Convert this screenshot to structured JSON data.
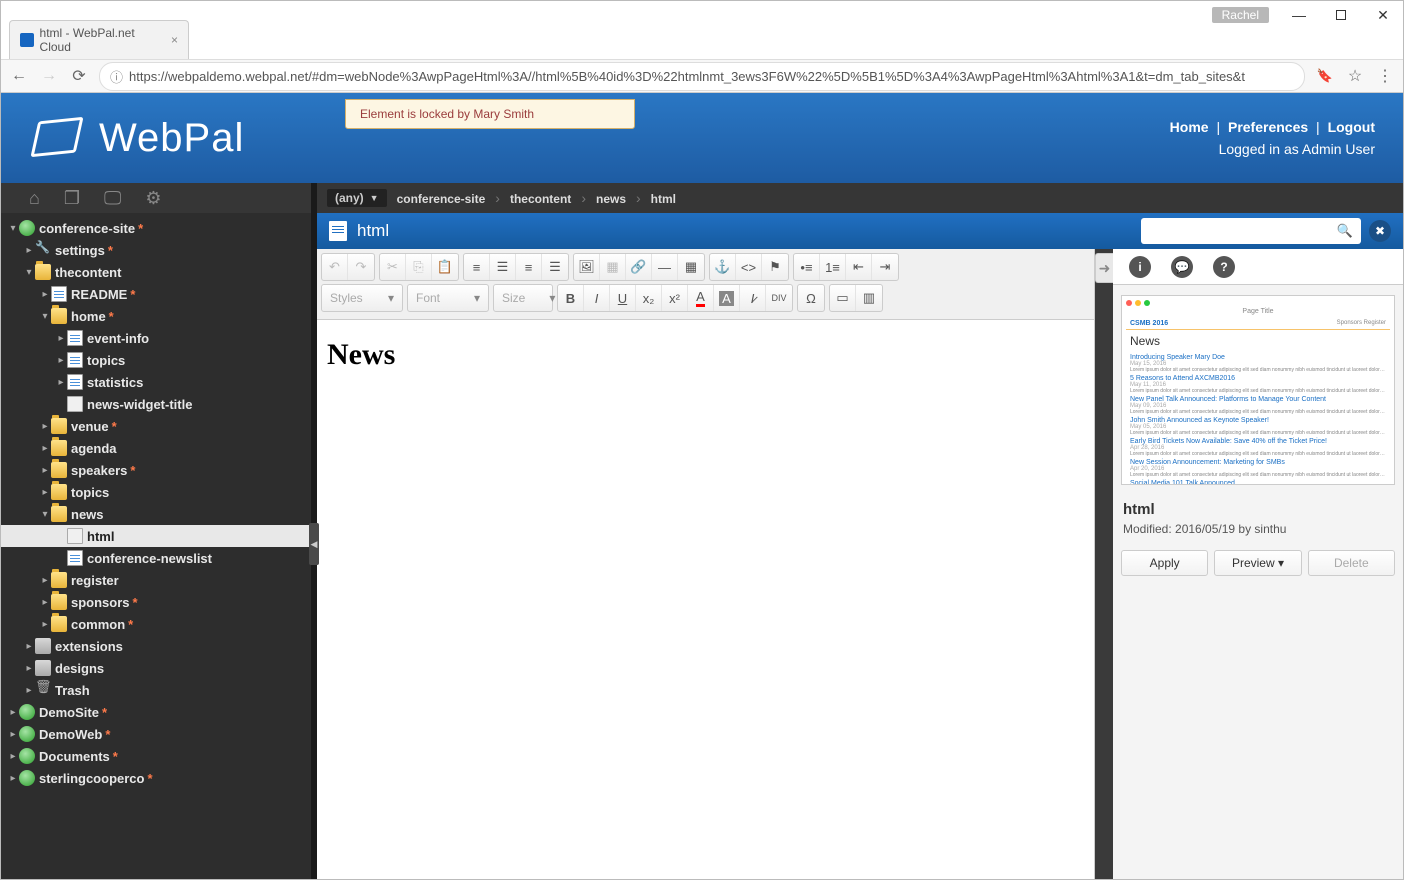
{
  "window": {
    "user_badge": "Rachel",
    "tab_title": "html - WebPal.net Cloud",
    "url": "https://webpaldemo.webpal.net/#dm=webNode%3AwpPageHtml%3A//html%5B%40id%3D%22htmlnmt_3ews3F6W%22%5D%5B1%5D%3A4%3AwpPageHtml%3Ahtml%3A1&t=dm_tab_sites&t"
  },
  "header": {
    "brand": "WebPal",
    "lock_msg": "Element is locked by Mary Smith",
    "links": {
      "home": "Home",
      "prefs": "Preferences",
      "logout": "Logout"
    },
    "login_status": "Logged in as Admin User"
  },
  "breadcrumb": {
    "any": "(any)",
    "items": [
      "conference-site",
      "thecontent",
      "news",
      "html"
    ]
  },
  "doc_title": "html",
  "editor": {
    "heading": "News",
    "dropdowns": {
      "styles": "Styles",
      "font": "Font",
      "size": "Size"
    }
  },
  "tree": [
    {
      "d": 0,
      "exp": "open",
      "ic": "globe",
      "label": "conference-site",
      "dirty": true
    },
    {
      "d": 1,
      "exp": "closed",
      "ic": "wrench",
      "label": "settings",
      "dirty": true
    },
    {
      "d": 1,
      "exp": "open",
      "ic": "folder",
      "label": "thecontent",
      "dirty": false
    },
    {
      "d": 2,
      "exp": "closed",
      "ic": "page",
      "label": "README",
      "dirty": true
    },
    {
      "d": 2,
      "exp": "open",
      "ic": "folder",
      "label": "home",
      "dirty": true
    },
    {
      "d": 3,
      "exp": "closed",
      "ic": "page",
      "label": "event-info",
      "dirty": false
    },
    {
      "d": 3,
      "exp": "closed",
      "ic": "page",
      "label": "topics",
      "dirty": false
    },
    {
      "d": 3,
      "exp": "closed",
      "ic": "page",
      "label": "statistics",
      "dirty": false
    },
    {
      "d": 3,
      "exp": "none",
      "ic": "file",
      "label": "news-widget-title",
      "dirty": false
    },
    {
      "d": 2,
      "exp": "closed",
      "ic": "folder",
      "label": "venue",
      "dirty": true
    },
    {
      "d": 2,
      "exp": "closed",
      "ic": "folder",
      "label": "agenda",
      "dirty": false
    },
    {
      "d": 2,
      "exp": "closed",
      "ic": "folder",
      "label": "speakers",
      "dirty": true
    },
    {
      "d": 2,
      "exp": "closed",
      "ic": "folder",
      "label": "topics",
      "dirty": false
    },
    {
      "d": 2,
      "exp": "open",
      "ic": "folder",
      "label": "news",
      "dirty": false
    },
    {
      "d": 3,
      "exp": "none",
      "ic": "file",
      "label": "html",
      "dirty": false,
      "sel": true
    },
    {
      "d": 3,
      "exp": "none",
      "ic": "page",
      "label": "conference-newslist",
      "dirty": false
    },
    {
      "d": 2,
      "exp": "closed",
      "ic": "folder",
      "label": "register",
      "dirty": false
    },
    {
      "d": 2,
      "exp": "closed",
      "ic": "folder",
      "label": "sponsors",
      "dirty": true
    },
    {
      "d": 2,
      "exp": "closed",
      "ic": "folder",
      "label": "common",
      "dirty": true
    },
    {
      "d": 1,
      "exp": "closed",
      "ic": "ext",
      "label": "extensions",
      "dirty": false
    },
    {
      "d": 1,
      "exp": "closed",
      "ic": "ext",
      "label": "designs",
      "dirty": false
    },
    {
      "d": 1,
      "exp": "closed",
      "ic": "trash",
      "label": "Trash",
      "dirty": false
    },
    {
      "d": 0,
      "exp": "closed",
      "ic": "globe",
      "label": "DemoSite",
      "dirty": true
    },
    {
      "d": 0,
      "exp": "closed",
      "ic": "globe",
      "label": "DemoWeb",
      "dirty": true
    },
    {
      "d": 0,
      "exp": "closed",
      "ic": "globe",
      "label": "Documents",
      "dirty": true
    },
    {
      "d": 0,
      "exp": "closed",
      "ic": "globe",
      "label": "sterlingcooperco",
      "dirty": true
    }
  ],
  "preview": {
    "page_title_label": "Page Title",
    "logo": "CSMB 2016",
    "nav_right": [
      "Sponsors",
      "Register"
    ],
    "heading": "News",
    "items": [
      {
        "title": "Introducing Speaker Mary Doe",
        "date": "May 15, 2016",
        "txt": "Lorem ipsum dolor sit amet consectetur adipiscing elit sed diam nonummy nibh euismod tincidunt ut laoreet dolore magna aliquam erat volutpat ut wisi enim ad minim"
      },
      {
        "title": "5 Reasons to Attend AXCMB2016",
        "date": "May 11, 2016",
        "txt": "Lorem ipsum dolor sit amet consectetur adipiscing elit sed diam nonummy nibh euismod tincidunt ut laoreet dolore magna aliquam erat volutpat ut wisi enim ad minim"
      },
      {
        "title": "New Panel Talk Announced: Platforms to Manage Your Content",
        "date": "May 09, 2016",
        "txt": "Lorem ipsum dolor sit amet consectetur adipiscing elit sed diam nonummy nibh euismod tincidunt ut laoreet dolore magna aliquam erat volutpat ut wisi enim ad minim"
      },
      {
        "title": "John Smith Announced as Keynote Speaker!",
        "date": "May 05, 2016",
        "txt": "Lorem ipsum dolor sit amet consectetur adipiscing elit sed diam nonummy nibh euismod tincidunt ut laoreet dolore magna aliquam erat volutpat ut wisi enim ad minim"
      },
      {
        "title": "Early Bird Tickets Now Available: Save 40% off the Ticket Price!",
        "date": "Apr 28, 2016",
        "txt": "Lorem ipsum dolor sit amet consectetur adipiscing elit sed diam nonummy nibh euismod tincidunt ut laoreet dolore magna aliquam erat volutpat ut wisi enim ad minim"
      },
      {
        "title": "New Session Announcement: Marketing for SMBs",
        "date": "Apr 20, 2016",
        "txt": "Lorem ipsum dolor sit amet consectetur adipiscing elit sed diam nonummy nibh euismod tincidunt ut laoreet dolore magna aliquam erat volutpat ut wisi enim ad minim"
      },
      {
        "title": "Social Media 101 Talk Announced",
        "date": "",
        "txt": ""
      }
    ]
  },
  "meta": {
    "title": "html",
    "modified": "Modified: 2016/05/19 by sinthu",
    "apply": "Apply",
    "preview": "Preview",
    "delete": "Delete"
  }
}
